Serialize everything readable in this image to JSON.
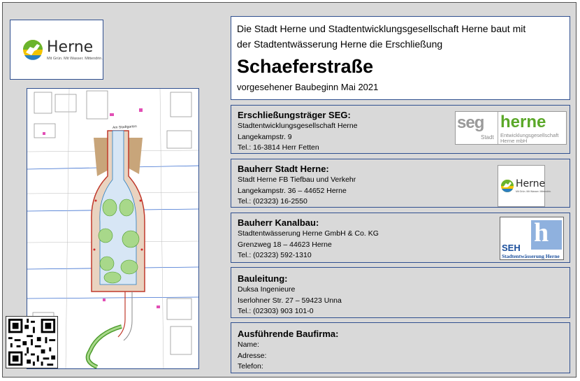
{
  "herne_logo": {
    "word": "Herne",
    "tagline": "Mit Grün. Mit Wasser. Mittendrin."
  },
  "header": {
    "intro_line1": "Die Stadt Herne und Stadtentwicklungsgesellschaft Herne baut mit",
    "intro_line2": "der Stadtentwässerung Herne die Erschließung",
    "title": "Schaeferstraße",
    "subtitle": "vorgesehener Baubeginn Mai 2021"
  },
  "blocks": [
    {
      "heading": "Erschließungsträger SEG:",
      "lines": [
        "Stadtentwicklungsgesellschaft Herne",
        "Langekampstr. 9",
        "Tel.: 16-3814 Herr Fetten"
      ],
      "logo": "seg-herne-logo"
    },
    {
      "heading": "Bauherr Stadt Herne:",
      "lines": [
        "Stadt Herne FB Tiefbau und Verkehr",
        "Langekampstr. 36 – 44652 Herne",
        "Tel.: (02323) 16-2550"
      ],
      "logo": "herne-logo"
    },
    {
      "heading": "Bauherr Kanalbau:",
      "lines": [
        "Stadtentwässerung Herne GmbH & Co. KG",
        "Grenzweg 18 – 44623 Herne",
        "Tel.: (02323) 592-1310"
      ],
      "logo": "seh-logo"
    },
    {
      "heading": "Bauleitung:",
      "lines": [
        "Duksa Ingenieure",
        "Iserlohner Str. 27 – 59423 Unna",
        "Tel.: (02303) 903 101-0"
      ]
    },
    {
      "heading": "Ausführende Baufirma:",
      "lines": [
        "Name:",
        "Adresse:",
        "Telefon:"
      ]
    }
  ],
  "seg_logo": {
    "seg": "seg",
    "stadt": "Stadt",
    "herne": "herne",
    "desc1": "Entwicklungsgesellschaft",
    "desc2": "Herne mbH"
  },
  "seh_logo": {
    "letters": "SEH",
    "text": "Stadtentwässerung Herne"
  },
  "map": {
    "street_label": "Am Stadtgarten"
  },
  "colors": {
    "frame": "#2f4f8f",
    "herne_green": "#6ab42d",
    "seg_green": "#5ba829",
    "seh_blue": "#1b4f9c",
    "background": "#d9d9d9"
  }
}
